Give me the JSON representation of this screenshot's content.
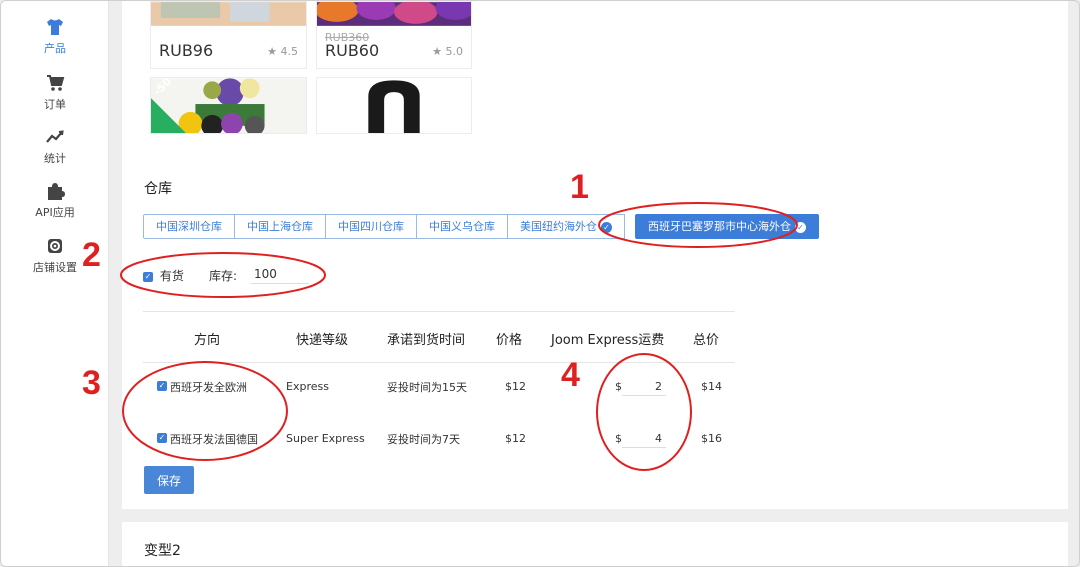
{
  "sidebar": {
    "items": [
      {
        "label": "产品",
        "icon": "tshirt-icon",
        "active": true
      },
      {
        "label": "订单",
        "icon": "cart-icon"
      },
      {
        "label": "统计",
        "icon": "chart-icon"
      },
      {
        "label": "API应用",
        "icon": "puzzle-icon"
      },
      {
        "label": "店铺设置",
        "icon": "gear-icon"
      }
    ]
  },
  "products": [
    {
      "price": "RUB96",
      "old_price": "",
      "rating": "★ 4.5"
    },
    {
      "price": "RUB60",
      "old_price": "RUB360",
      "rating": "★ 5.0"
    },
    {
      "badge": "-50%"
    },
    {}
  ],
  "warehouse": {
    "title": "仓库",
    "tabs": [
      {
        "label": "中国深圳仓库",
        "checked": false
      },
      {
        "label": "中国上海仓库",
        "checked": false
      },
      {
        "label": "中国四川仓库",
        "checked": false
      },
      {
        "label": "中国义乌仓库",
        "checked": false
      },
      {
        "label": "美国纽约海外仓",
        "checked": true
      },
      {
        "label": "西班牙巴塞罗那市中心海外仓",
        "checked": true,
        "active": true
      }
    ],
    "in_stock_label": "有货",
    "stock_label": "库存:",
    "stock_value": "100"
  },
  "shipping_table": {
    "headers": [
      "方向",
      "快递等级",
      "承诺到货时间",
      "价格",
      "Joom Express运费",
      "总价"
    ],
    "rows": [
      {
        "direction": "西班牙发全欧洲",
        "level": "Express",
        "time": "妥投时间为15天",
        "price": "$12",
        "currency": "$",
        "fee": "2",
        "total": "$14"
      },
      {
        "direction": "西班牙发法国德国",
        "level": "Super Express",
        "time": "妥投时间为7天",
        "price": "$12",
        "currency": "$",
        "fee": "4",
        "total": "$16"
      }
    ]
  },
  "save_label": "保存",
  "variant2_title": "变型2",
  "annotations": [
    "1",
    "2",
    "3",
    "4"
  ],
  "colors": {
    "accent": "#3b7dd8",
    "annotation": "#e02020"
  }
}
